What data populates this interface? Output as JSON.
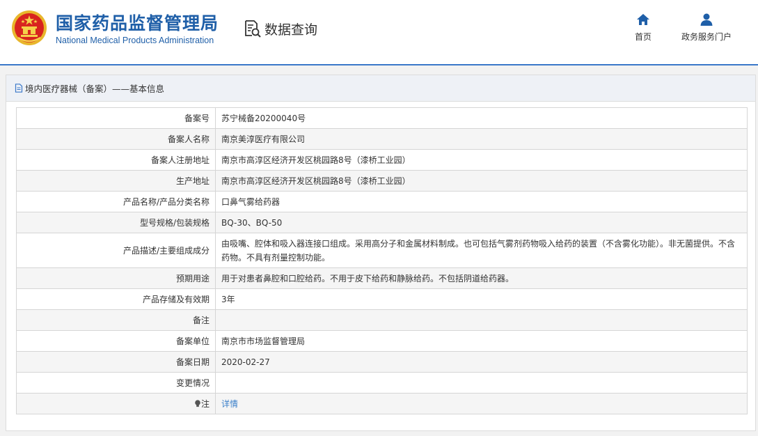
{
  "header": {
    "brand_cn": "国家药品监督管理局",
    "brand_en": "National Medical Products Administration",
    "query_label": "数据查询",
    "nav": [
      {
        "label": "首页",
        "icon": "home-icon"
      },
      {
        "label": "政务服务门户",
        "icon": "user-icon"
      }
    ],
    "colors": {
      "brand": "#1f5fa8",
      "accent": "#3a78c9"
    }
  },
  "panel": {
    "title": "境内医疗器械（备案）——基本信息",
    "rows": [
      {
        "label": "备案号",
        "value": "苏宁械备20200040号"
      },
      {
        "label": "备案人名称",
        "value": "南京美淳医疗有限公司"
      },
      {
        "label": "备案人注册地址",
        "value": "南京市高淳区经济开发区桃园路8号（漆桥工业园）"
      },
      {
        "label": "生产地址",
        "value": "南京市高淳区经济开发区桃园路8号（漆桥工业园）"
      },
      {
        "label": "产品名称/产品分类名称",
        "value": "口鼻气雾给药器"
      },
      {
        "label": "型号规格/包装规格",
        "value": "BQ-30、BQ-50"
      },
      {
        "label": "产品描述/主要组成成分",
        "value": "由吸嘴、腔体和吸入器连接口组成。采用高分子和金属材料制成。也可包括气雾剂药物吸入给药的装置（不含雾化功能）。非无菌提供。不含药物。不具有剂量控制功能。"
      },
      {
        "label": "预期用途",
        "value": "用于对患者鼻腔和口腔给药。不用于皮下给药和静脉给药。不包括阴道给药器。"
      },
      {
        "label": "产品存储及有效期",
        "value": "3年"
      },
      {
        "label": "备注",
        "value": ""
      },
      {
        "label": "备案单位",
        "value": "南京市市场监督管理局"
      },
      {
        "label": "备案日期",
        "value": "2020-02-27"
      },
      {
        "label": "变更情况",
        "value": ""
      },
      {
        "label": "注",
        "value": "详情",
        "icon": "bulb-icon"
      }
    ]
  }
}
